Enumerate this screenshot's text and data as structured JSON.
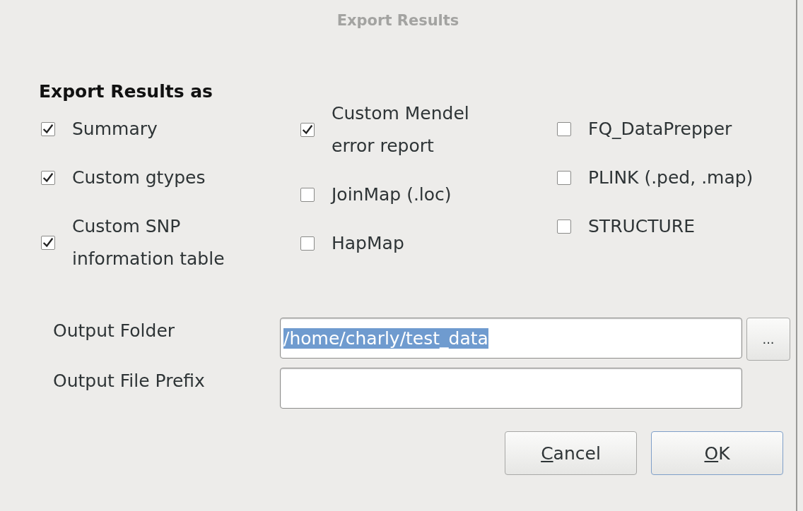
{
  "window": {
    "title": "Export Results"
  },
  "section": {
    "heading": "Export Results as"
  },
  "columns": [
    [
      {
        "label": "Summary",
        "checked": true
      },
      {
        "label": "Custom gtypes",
        "checked": true
      },
      {
        "label": "Custom SNP information table",
        "checked": true
      }
    ],
    [
      {
        "label": "Custom Mendel error report",
        "checked": true
      },
      {
        "label": "JoinMap (.loc)",
        "checked": false
      },
      {
        "label": "HapMap",
        "checked": false
      }
    ],
    [
      {
        "label": "FQ_DataPrepper",
        "checked": false
      },
      {
        "label": "PLINK (.ped, .map)",
        "checked": false
      },
      {
        "label": "STRUCTURE",
        "checked": false
      }
    ]
  ],
  "output_folder": {
    "label": "Output Folder",
    "value": "/home/charly/test_data",
    "value_selected": true,
    "browse_button": "..."
  },
  "output_file_prefix": {
    "label": "Output File Prefix"
  },
  "buttons": [
    {
      "label": "Cancel",
      "mnemonic": true,
      "default": false
    },
    {
      "label": "OK",
      "mnemonic": true,
      "default": true
    }
  ]
}
